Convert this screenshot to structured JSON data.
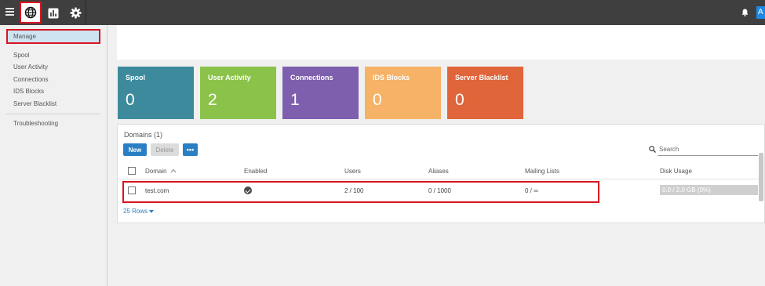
{
  "topbar": {
    "icons": [
      "menu-icon",
      "globe-icon",
      "chart-icon",
      "gear-icon",
      "bell-icon"
    ],
    "avatar_letter": "A"
  },
  "sidebar": {
    "active": "Manage",
    "items": [
      "Spool",
      "User Activity",
      "Connections",
      "IDS Blocks",
      "Server Blacklist"
    ],
    "bottom_item": "Troubleshooting"
  },
  "tiles": [
    {
      "label": "Spool",
      "count": "0",
      "color": "#3d8a9c"
    },
    {
      "label": "User Activity",
      "count": "2",
      "color": "#8bc34a"
    },
    {
      "label": "Connections",
      "count": "1",
      "color": "#7e5fad"
    },
    {
      "label": "IDS Blocks",
      "count": "0",
      "color": "#f6b266"
    },
    {
      "label": "Server Blacklist",
      "count": "0",
      "color": "#e0653a"
    }
  ],
  "domains": {
    "title": "Domains (1)",
    "new_label": "New",
    "delete_label": "Delete",
    "more_label": "•••",
    "search_placeholder": "Search",
    "columns": {
      "domain": "Domain",
      "enabled": "Enabled",
      "users": "Users",
      "aliases": "Aliases",
      "mailing_lists": "Mailing Lists",
      "disk_usage": "Disk Usage"
    },
    "rows": [
      {
        "domain": "test.com",
        "enabled": true,
        "users": "2 / 100",
        "aliases": "0 / 1000",
        "mailing_lists": "0 / ∞",
        "disk_usage": "0.0 / 2.0 GB (0%)"
      }
    ],
    "rows_per_page": "25 Rows"
  }
}
